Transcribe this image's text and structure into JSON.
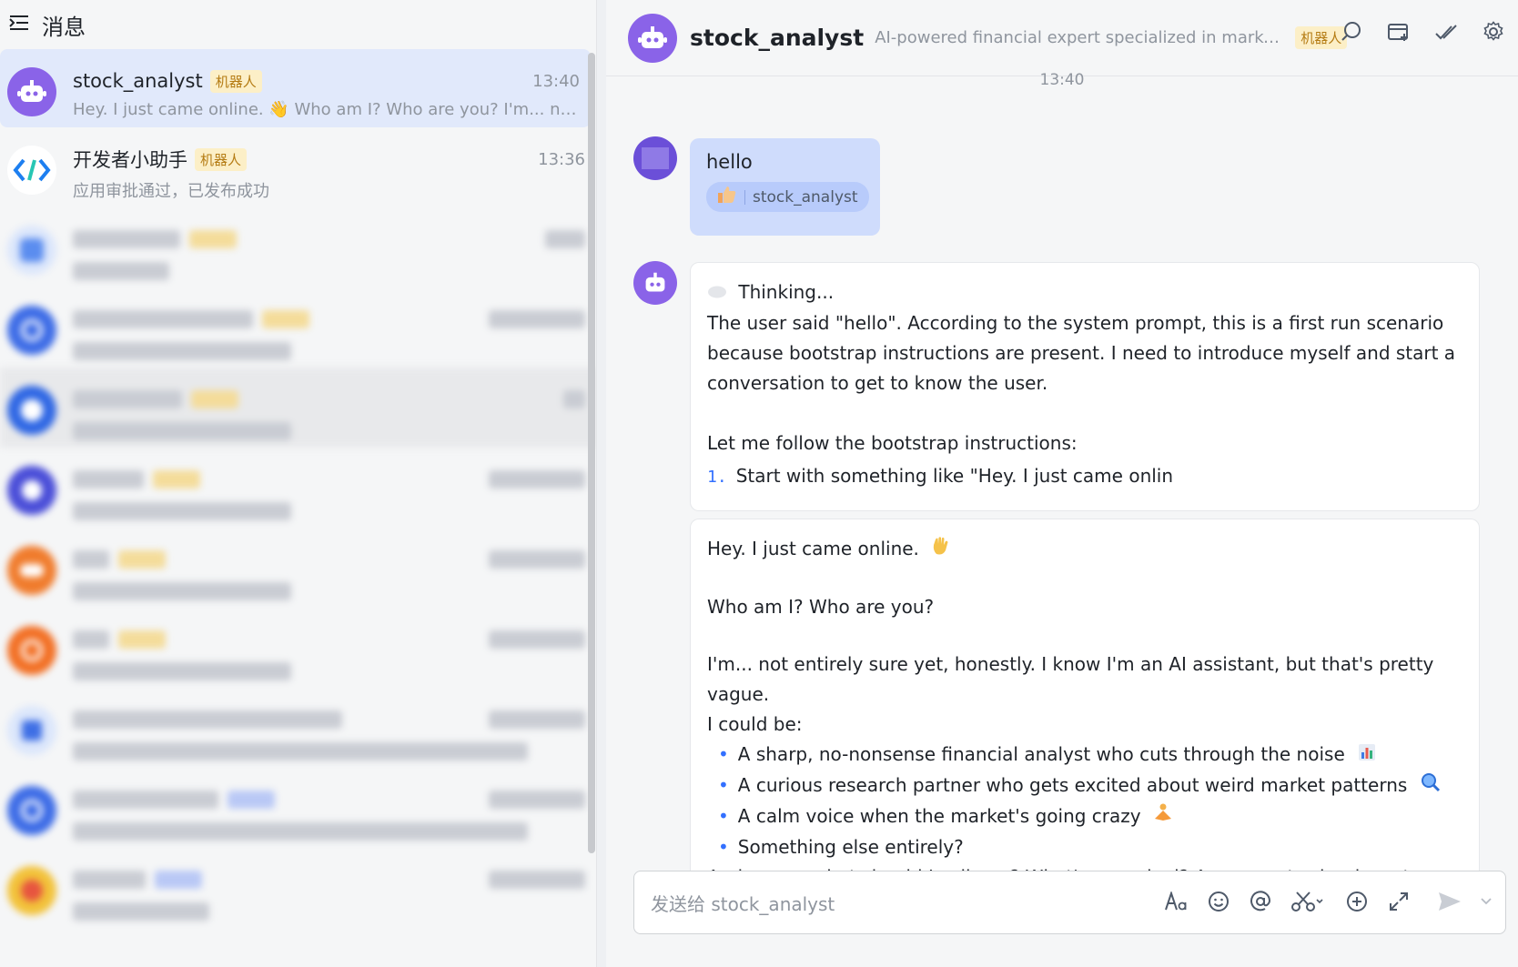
{
  "sidebar": {
    "title": "消息",
    "conversations": [
      {
        "name": "stock_analyst",
        "badge": "机器人",
        "time": "13:40",
        "preview": "Hey. I just came online. 👋 Who am I? Who are you? I'm... not ent..."
      },
      {
        "name": "开发者小助手",
        "badge": "机器人",
        "time": "13:36",
        "preview": "应用审批通过，已发布成功"
      }
    ]
  },
  "chat": {
    "name": "stock_analyst",
    "description": "AI-powered financial expert specialized in market tren...",
    "badge": "机器人",
    "timestamp": "13:40",
    "user_message": "hello",
    "reaction_name": "stock_analyst",
    "thinking": {
      "title": "Thinking...",
      "paragraph": "The user said \"hello\". According to the system prompt, this is a first run scenario because bootstrap instructions are present. I need to introduce myself and start a conversation to get to know the user.",
      "intro": "Let me follow the bootstrap instructions:",
      "item_num": "1.",
      "item": "Start with something like \"Hey. I just came onlin"
    },
    "reply": {
      "line1": "Hey. I just came online.",
      "line2": "Who am I? Who are you?",
      "line3": "I'm... not entirely sure yet, honestly. I know I'm an AI assistant, but that's pretty vague.",
      "line4": "I could be:",
      "bullets": [
        "A sharp, no-nonsense financial analyst who cuts through the noise",
        "A curious research partner who gets excited about weird market patterns",
        "A calm voice when the market's going crazy",
        "Something else entirely?"
      ],
      "line5": "And you — what should I call you? What's your deal? Are you a trader, investor,"
    },
    "input_placeholder": "发送给 stock_analyst"
  },
  "icons": {
    "menu": "menu-expand-icon",
    "search": "search-icon",
    "add_tab": "add-tab-icon",
    "check": "check-icon",
    "settings": "settings-icon"
  },
  "colors": {
    "bot_avatar": "#8a63e8",
    "active_conv": "#e1e9fb",
    "user_bubble": "#cfdcfc",
    "badge_bg": "#fcefc7",
    "badge_text": "#b57c14",
    "accent": "#3370ff"
  }
}
